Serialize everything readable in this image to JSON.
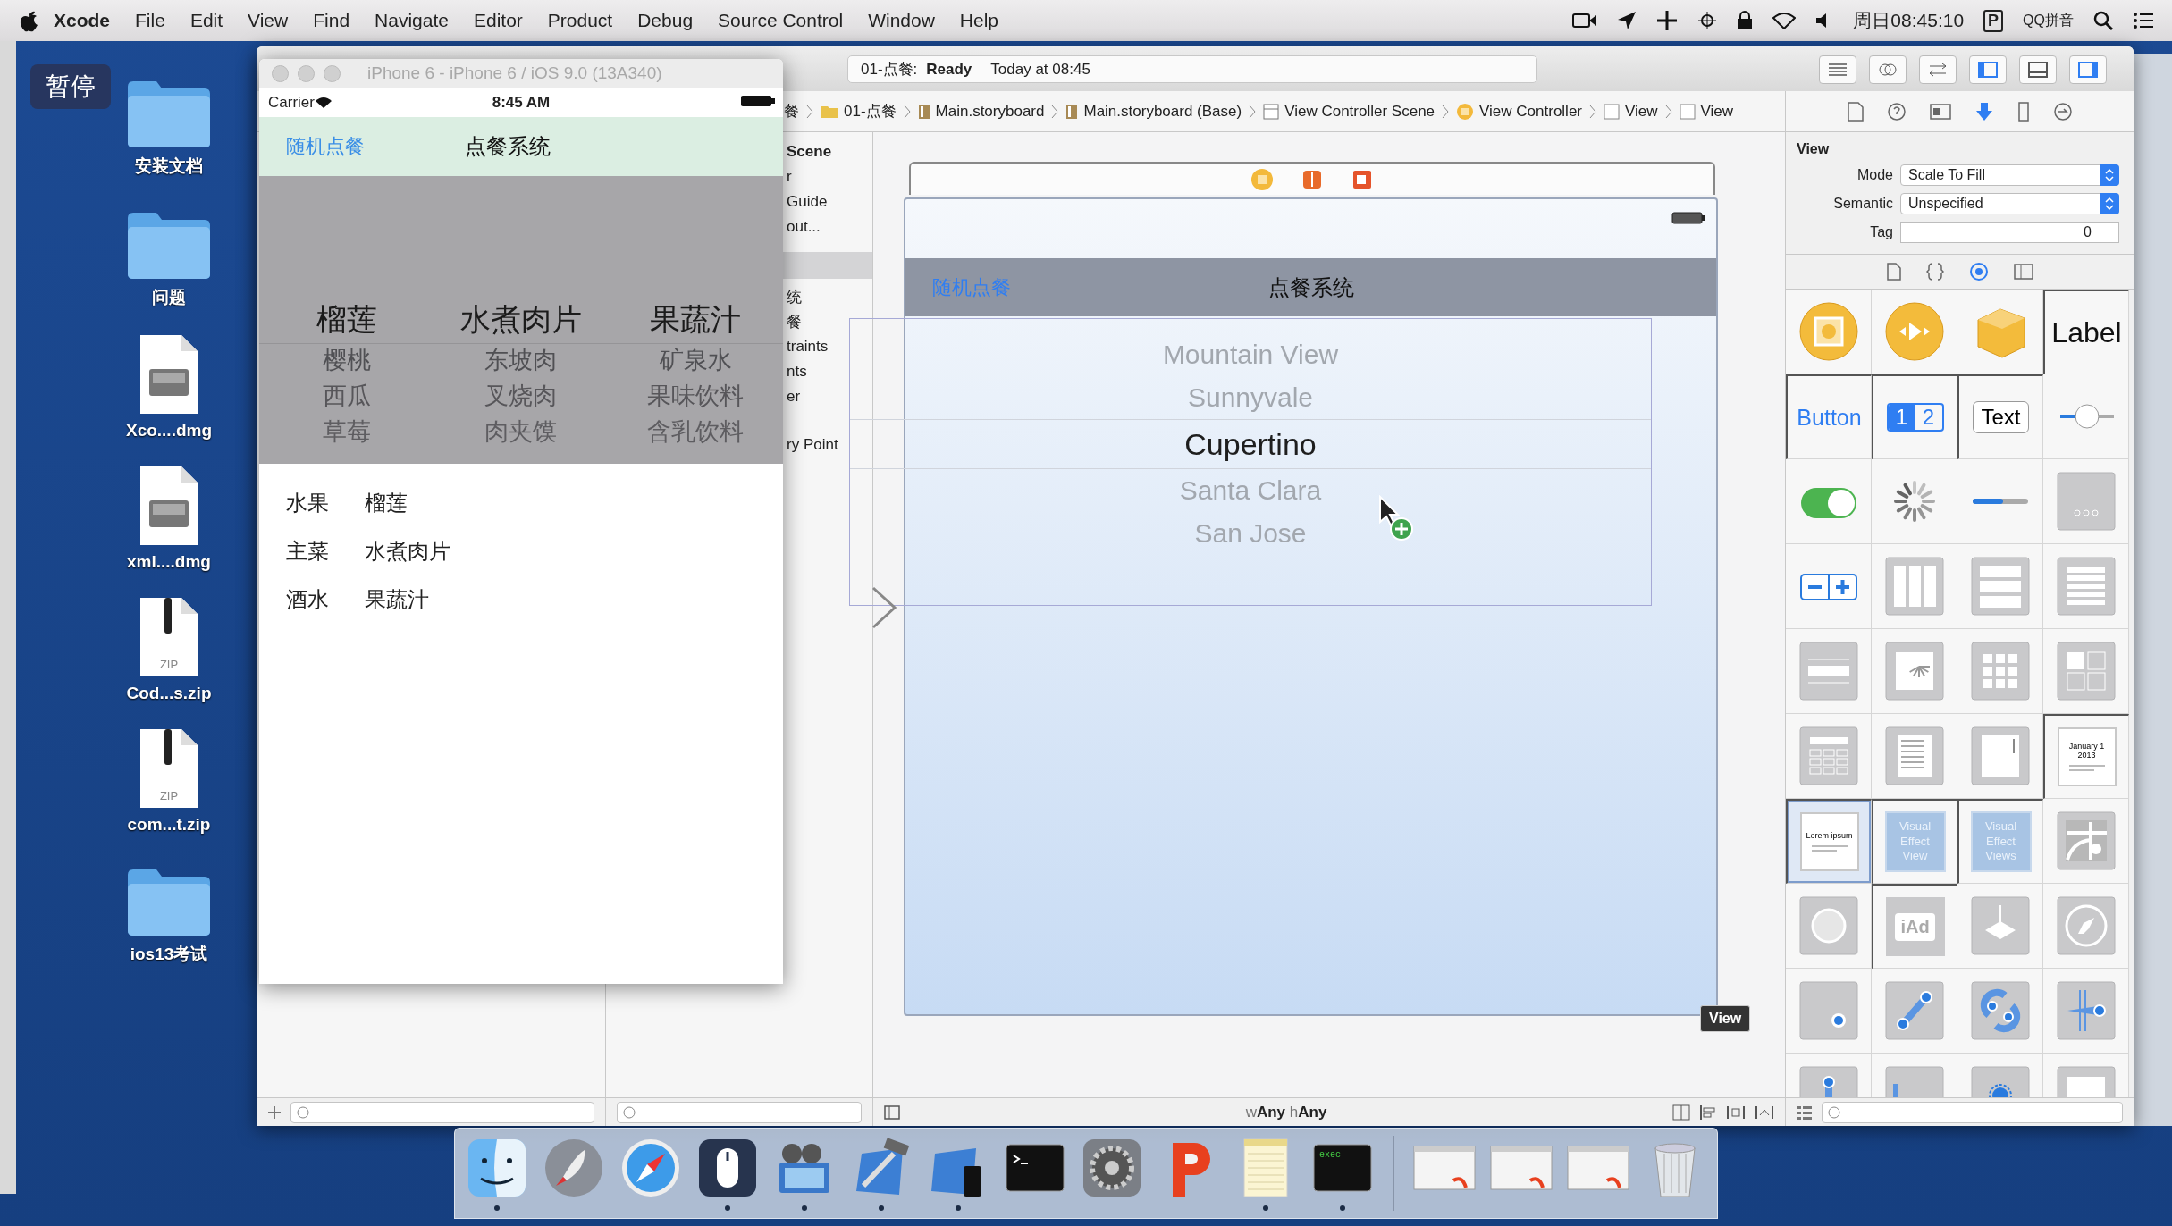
{
  "menu_bar": {
    "app_name": "Xcode",
    "menus": [
      "File",
      "Edit",
      "View",
      "Find",
      "Navigate",
      "Editor",
      "Product",
      "Debug",
      "Source Control",
      "Window",
      "Help"
    ],
    "clock": "周日08:45:10",
    "input_method_badge": "P",
    "input_method": "QQ拼音"
  },
  "pause_badge": "暂停",
  "desktop_items": [
    {
      "label": "安装文档",
      "kind": "folder"
    },
    {
      "label": "问题",
      "kind": "folder"
    },
    {
      "label": "Xco....dmg",
      "kind": "dmg"
    },
    {
      "label": "xmi....dmg",
      "kind": "dmg"
    },
    {
      "label": "Cod...s.zip",
      "kind": "zip",
      "badge": "ZIP"
    },
    {
      "label": "com...t.zip",
      "kind": "zip",
      "badge": "ZIP"
    },
    {
      "label": "ios13考试",
      "kind": "folder"
    }
  ],
  "simulator": {
    "title": "iPhone 6 - iPhone 6 / iOS 9.0 (13A340)",
    "status_bar": {
      "carrier": "Carrier",
      "time": "8:45 AM"
    },
    "nav_bar": {
      "left_button": "随机点餐",
      "title": "点餐系统"
    },
    "picker_columns": [
      {
        "rows": [
          {
            "text": "榴莲",
            "selected": true
          },
          {
            "text": "樱桃",
            "selected": false
          },
          {
            "text": "西瓜",
            "selected": false
          },
          {
            "text": "草莓",
            "selected": false
          }
        ]
      },
      {
        "rows": [
          {
            "text": "水煮肉片",
            "selected": true
          },
          {
            "text": "东坡肉",
            "selected": false
          },
          {
            "text": "叉烧肉",
            "selected": false
          },
          {
            "text": "肉夹馍",
            "selected": false
          }
        ]
      },
      {
        "rows": [
          {
            "text": "果蔬汁",
            "selected": true
          },
          {
            "text": "矿泉水",
            "selected": false
          },
          {
            "text": "果味饮料",
            "selected": false
          },
          {
            "text": "含乳饮料",
            "selected": false
          }
        ]
      }
    ],
    "results": [
      {
        "label": "水果",
        "value": "榴莲"
      },
      {
        "label": "主菜",
        "value": "水煮肉片"
      },
      {
        "label": "酒水",
        "value": "果蔬汁"
      }
    ]
  },
  "xcode": {
    "status": {
      "scheme": "01-点餐:",
      "state": "Ready",
      "time": "Today at 08:45"
    },
    "breadcrumbs": [
      {
        "label": "餐",
        "kind": "text"
      },
      {
        "label": "01-点餐",
        "kind": "folder"
      },
      {
        "label": "Main.storyboard",
        "kind": "file"
      },
      {
        "label": "Main.storyboard (Base)",
        "kind": "file"
      },
      {
        "label": "View Controller Scene",
        "kind": "scene"
      },
      {
        "label": "View Controller",
        "kind": "controller"
      },
      {
        "label": "View",
        "kind": "view"
      },
      {
        "label": "View",
        "kind": "view"
      }
    ],
    "outline": [
      "Scene",
      "r",
      "Guide",
      "out...",
      "统",
      "餐",
      "traints",
      "nts",
      "er",
      "ry Point"
    ],
    "canvas": {
      "nav_left": "随机点餐",
      "nav_title": "点餐系统",
      "picker_rows": [
        {
          "text": "Mountain View",
          "selected": false
        },
        {
          "text": "Sunnyvale",
          "selected": false
        },
        {
          "text": "Cupertino",
          "selected": true
        },
        {
          "text": "Santa Clara",
          "selected": false
        },
        {
          "text": "San Jose",
          "selected": false
        }
      ],
      "tooltip": "View",
      "size_class": "w**Any** h**Any**"
    },
    "inspector": {
      "section": "View",
      "fields": [
        {
          "label": "Mode",
          "value": "Scale To Fill",
          "kind": "popup"
        },
        {
          "label": "Semantic",
          "value": "Unspecified",
          "kind": "popup"
        },
        {
          "label": "Tag",
          "value": "0",
          "kind": "stepper"
        }
      ],
      "library": [
        {
          "kind": "object",
          "selected": false
        },
        {
          "kind": "media",
          "selected": false
        },
        {
          "kind": "cube",
          "selected": false
        },
        {
          "kind": "label",
          "text": "Label",
          "selected": false
        },
        {
          "kind": "button",
          "text": "Button",
          "selected": false
        },
        {
          "kind": "segmented",
          "segments": [
            "1",
            "2"
          ],
          "selected": false
        },
        {
          "kind": "textfield",
          "text": "Text",
          "selected": false
        },
        {
          "kind": "slider",
          "selected": false
        },
        {
          "kind": "switch",
          "selected": false
        },
        {
          "kind": "spinner",
          "selected": false
        },
        {
          "kind": "progress",
          "selected": false
        },
        {
          "kind": "pagecontrol",
          "selected": false
        },
        {
          "kind": "stepper",
          "selected": false
        },
        {
          "kind": "columns",
          "selected": false
        },
        {
          "kind": "rows",
          "selected": false
        },
        {
          "kind": "table",
          "selected": false
        },
        {
          "kind": "cell",
          "selected": false
        },
        {
          "kind": "image",
          "selected": false
        },
        {
          "kind": "grid",
          "selected": false
        },
        {
          "kind": "quad",
          "selected": false
        },
        {
          "kind": "keypad",
          "selected": false
        },
        {
          "kind": "textview",
          "selected": false
        },
        {
          "kind": "scroll",
          "selected": false
        },
        {
          "kind": "datepicker",
          "text": "January 1 2013",
          "selected": false
        },
        {
          "kind": "webview",
          "text": "Lorem ipsum",
          "selected": true
        },
        {
          "kind": "effect",
          "text": "Visual Effect View",
          "selected": false
        },
        {
          "kind": "effect",
          "text": "Visual Effect Views",
          "selected": false
        },
        {
          "kind": "map",
          "selected": false
        },
        {
          "kind": "sphere",
          "selected": false
        },
        {
          "kind": "ad",
          "text": "iAd",
          "selected": false
        },
        {
          "kind": "plane",
          "selected": false
        },
        {
          "kind": "compass",
          "selected": false
        },
        {
          "kind": "tap",
          "selected": false
        },
        {
          "kind": "pinch",
          "selected": false
        },
        {
          "kind": "rotate",
          "selected": false
        },
        {
          "kind": "swipe",
          "selected": false
        },
        {
          "kind": "pan",
          "selected": false
        },
        {
          "kind": "longpress",
          "selected": false
        },
        {
          "kind": "edge",
          "selected": false
        },
        {
          "kind": "blank",
          "selected": false
        }
      ]
    }
  },
  "dock": [
    {
      "kind": "finder",
      "running": true
    },
    {
      "kind": "rocket",
      "running": false
    },
    {
      "kind": "compass",
      "running": false
    },
    {
      "kind": "mouse",
      "running": true
    },
    {
      "kind": "film",
      "running": true
    },
    {
      "kind": "hammer",
      "running": true
    },
    {
      "kind": "blueprint",
      "running": true
    },
    {
      "kind": "terminal",
      "running": false
    },
    {
      "kind": "gear",
      "running": false
    },
    {
      "kind": "pshape",
      "running": false
    },
    {
      "kind": "notes",
      "running": true
    },
    {
      "kind": "exec",
      "label": "exec",
      "running": true
    },
    {
      "kind": "separator"
    },
    {
      "kind": "thumb",
      "running": false
    },
    {
      "kind": "thumb",
      "running": false
    },
    {
      "kind": "thumb",
      "running": false
    },
    {
      "kind": "trash",
      "running": false
    }
  ]
}
